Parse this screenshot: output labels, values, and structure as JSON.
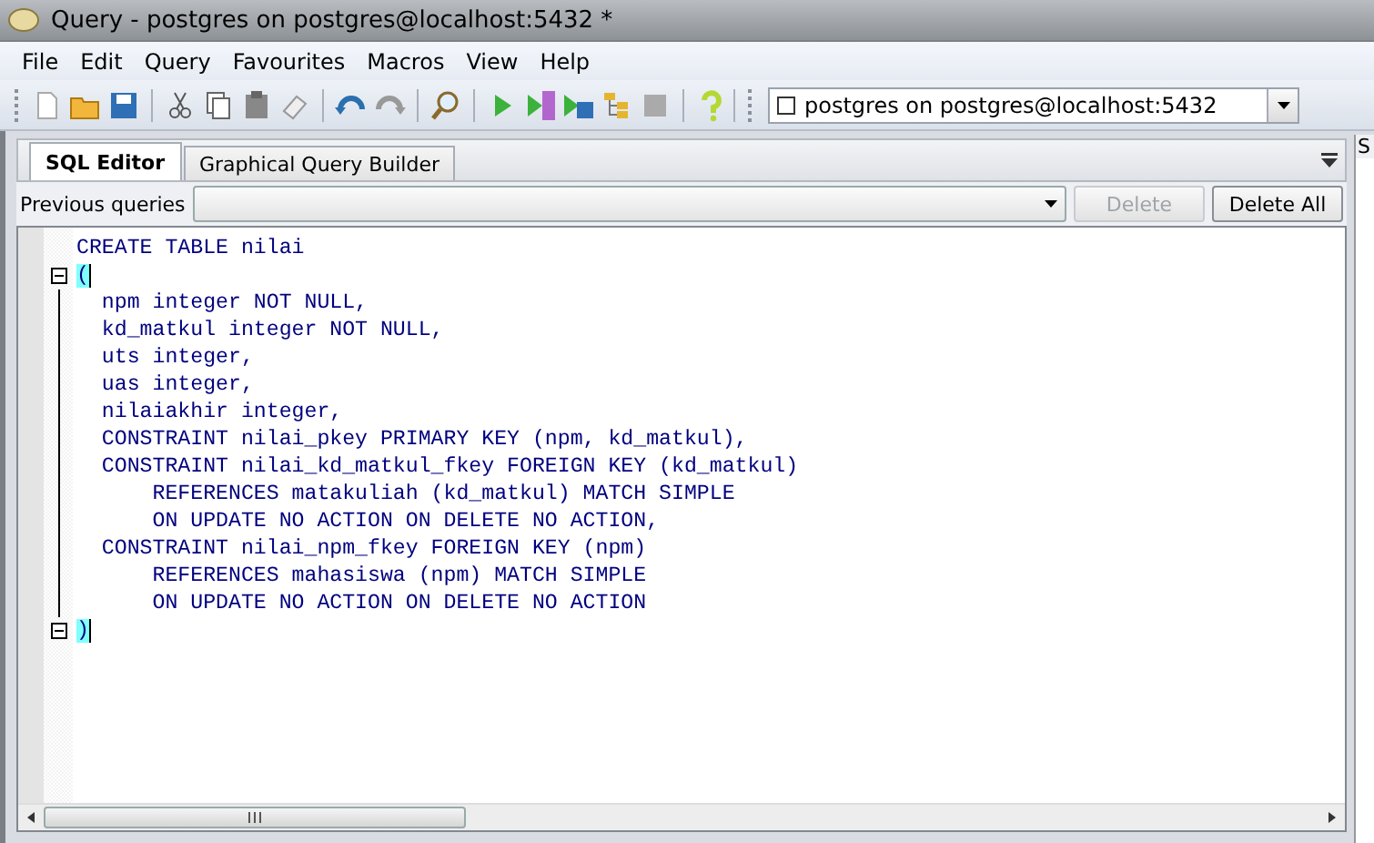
{
  "window": {
    "title": "Query - postgres on postgres@localhost:5432 *"
  },
  "menu": [
    "File",
    "Edit",
    "Query",
    "Favourites",
    "Macros",
    "View",
    "Help"
  ],
  "connection": {
    "value": "postgres on postgres@localhost:5432",
    "checked": false
  },
  "tabs": [
    {
      "label": "SQL Editor",
      "selected": true
    },
    {
      "label": "Graphical Query Builder",
      "selected": false
    }
  ],
  "side_panel": {
    "title": "S"
  },
  "previous_queries": {
    "label": "Previous queries",
    "buttons": [
      {
        "label": "Delete",
        "disabled": true
      },
      {
        "label": "Delete All",
        "disabled": false
      }
    ]
  },
  "editor": {
    "lines": [
      {
        "text": "CREATE TABLE nilai",
        "kind": "plain",
        "bracket": false
      },
      {
        "text": "(",
        "kind": "foldstart",
        "bracket": true
      },
      {
        "text": "  npm integer NOT NULL,",
        "kind": "inside",
        "bracket": false
      },
      {
        "text": "  kd_matkul integer NOT NULL,",
        "kind": "inside",
        "bracket": false
      },
      {
        "text": "  uts integer,",
        "kind": "inside",
        "bracket": false
      },
      {
        "text": "  uas integer,",
        "kind": "inside",
        "bracket": false
      },
      {
        "text": "  nilaiakhir integer,",
        "kind": "inside",
        "bracket": false
      },
      {
        "text": "  CONSTRAINT nilai_pkey PRIMARY KEY (npm, kd_matkul),",
        "kind": "inside",
        "bracket": false
      },
      {
        "text": "  CONSTRAINT nilai_kd_matkul_fkey FOREIGN KEY (kd_matkul)",
        "kind": "inside",
        "bracket": false
      },
      {
        "text": "      REFERENCES matakuliah (kd_matkul) MATCH SIMPLE",
        "kind": "inside",
        "bracket": false
      },
      {
        "text": "      ON UPDATE NO ACTION ON DELETE NO ACTION,",
        "kind": "inside",
        "bracket": false
      },
      {
        "text": "  CONSTRAINT nilai_npm_fkey FOREIGN KEY (npm)",
        "kind": "inside",
        "bracket": false
      },
      {
        "text": "      REFERENCES mahasiswa (npm) MATCH SIMPLE",
        "kind": "inside",
        "bracket": false
      },
      {
        "text": "      ON UPDATE NO ACTION ON DELETE NO ACTION",
        "kind": "inside",
        "bracket": false
      },
      {
        "text": ")",
        "kind": "foldend",
        "bracket": true
      }
    ]
  }
}
